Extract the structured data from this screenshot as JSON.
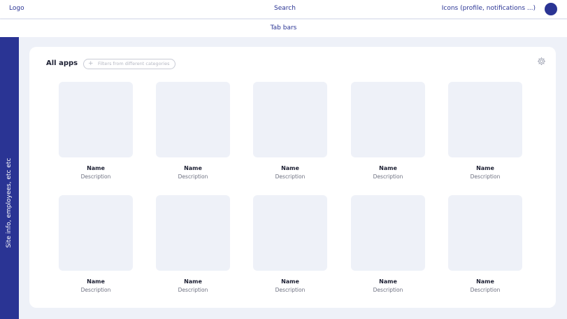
{
  "header": {
    "logo": "Logo",
    "search": "Search",
    "icons_label": "Icons (profile, notifications ...)"
  },
  "tabs": {
    "label": "Tab bars"
  },
  "sidebar": {
    "label": "Site info, employees, etc etc"
  },
  "main": {
    "title": "All apps",
    "filter_placeholder": "Filters from different categories",
    "apps": [
      {
        "name": "Name",
        "description": "Description"
      },
      {
        "name": "Name",
        "description": "Description"
      },
      {
        "name": "Name",
        "description": "Description"
      },
      {
        "name": "Name",
        "description": "Description"
      },
      {
        "name": "Name",
        "description": "Description"
      },
      {
        "name": "Name",
        "description": "Description"
      },
      {
        "name": "Name",
        "description": "Description"
      },
      {
        "name": "Name",
        "description": "Description"
      },
      {
        "name": "Name",
        "description": "Description"
      },
      {
        "name": "Name",
        "description": "Description"
      }
    ]
  },
  "icons": {
    "avatar": "avatar-icon",
    "filter": "plus-icon",
    "settings": "gear-icon"
  },
  "colors": {
    "accent": "#2a3494",
    "background": "#eef1f8",
    "card": "#ffffff"
  }
}
